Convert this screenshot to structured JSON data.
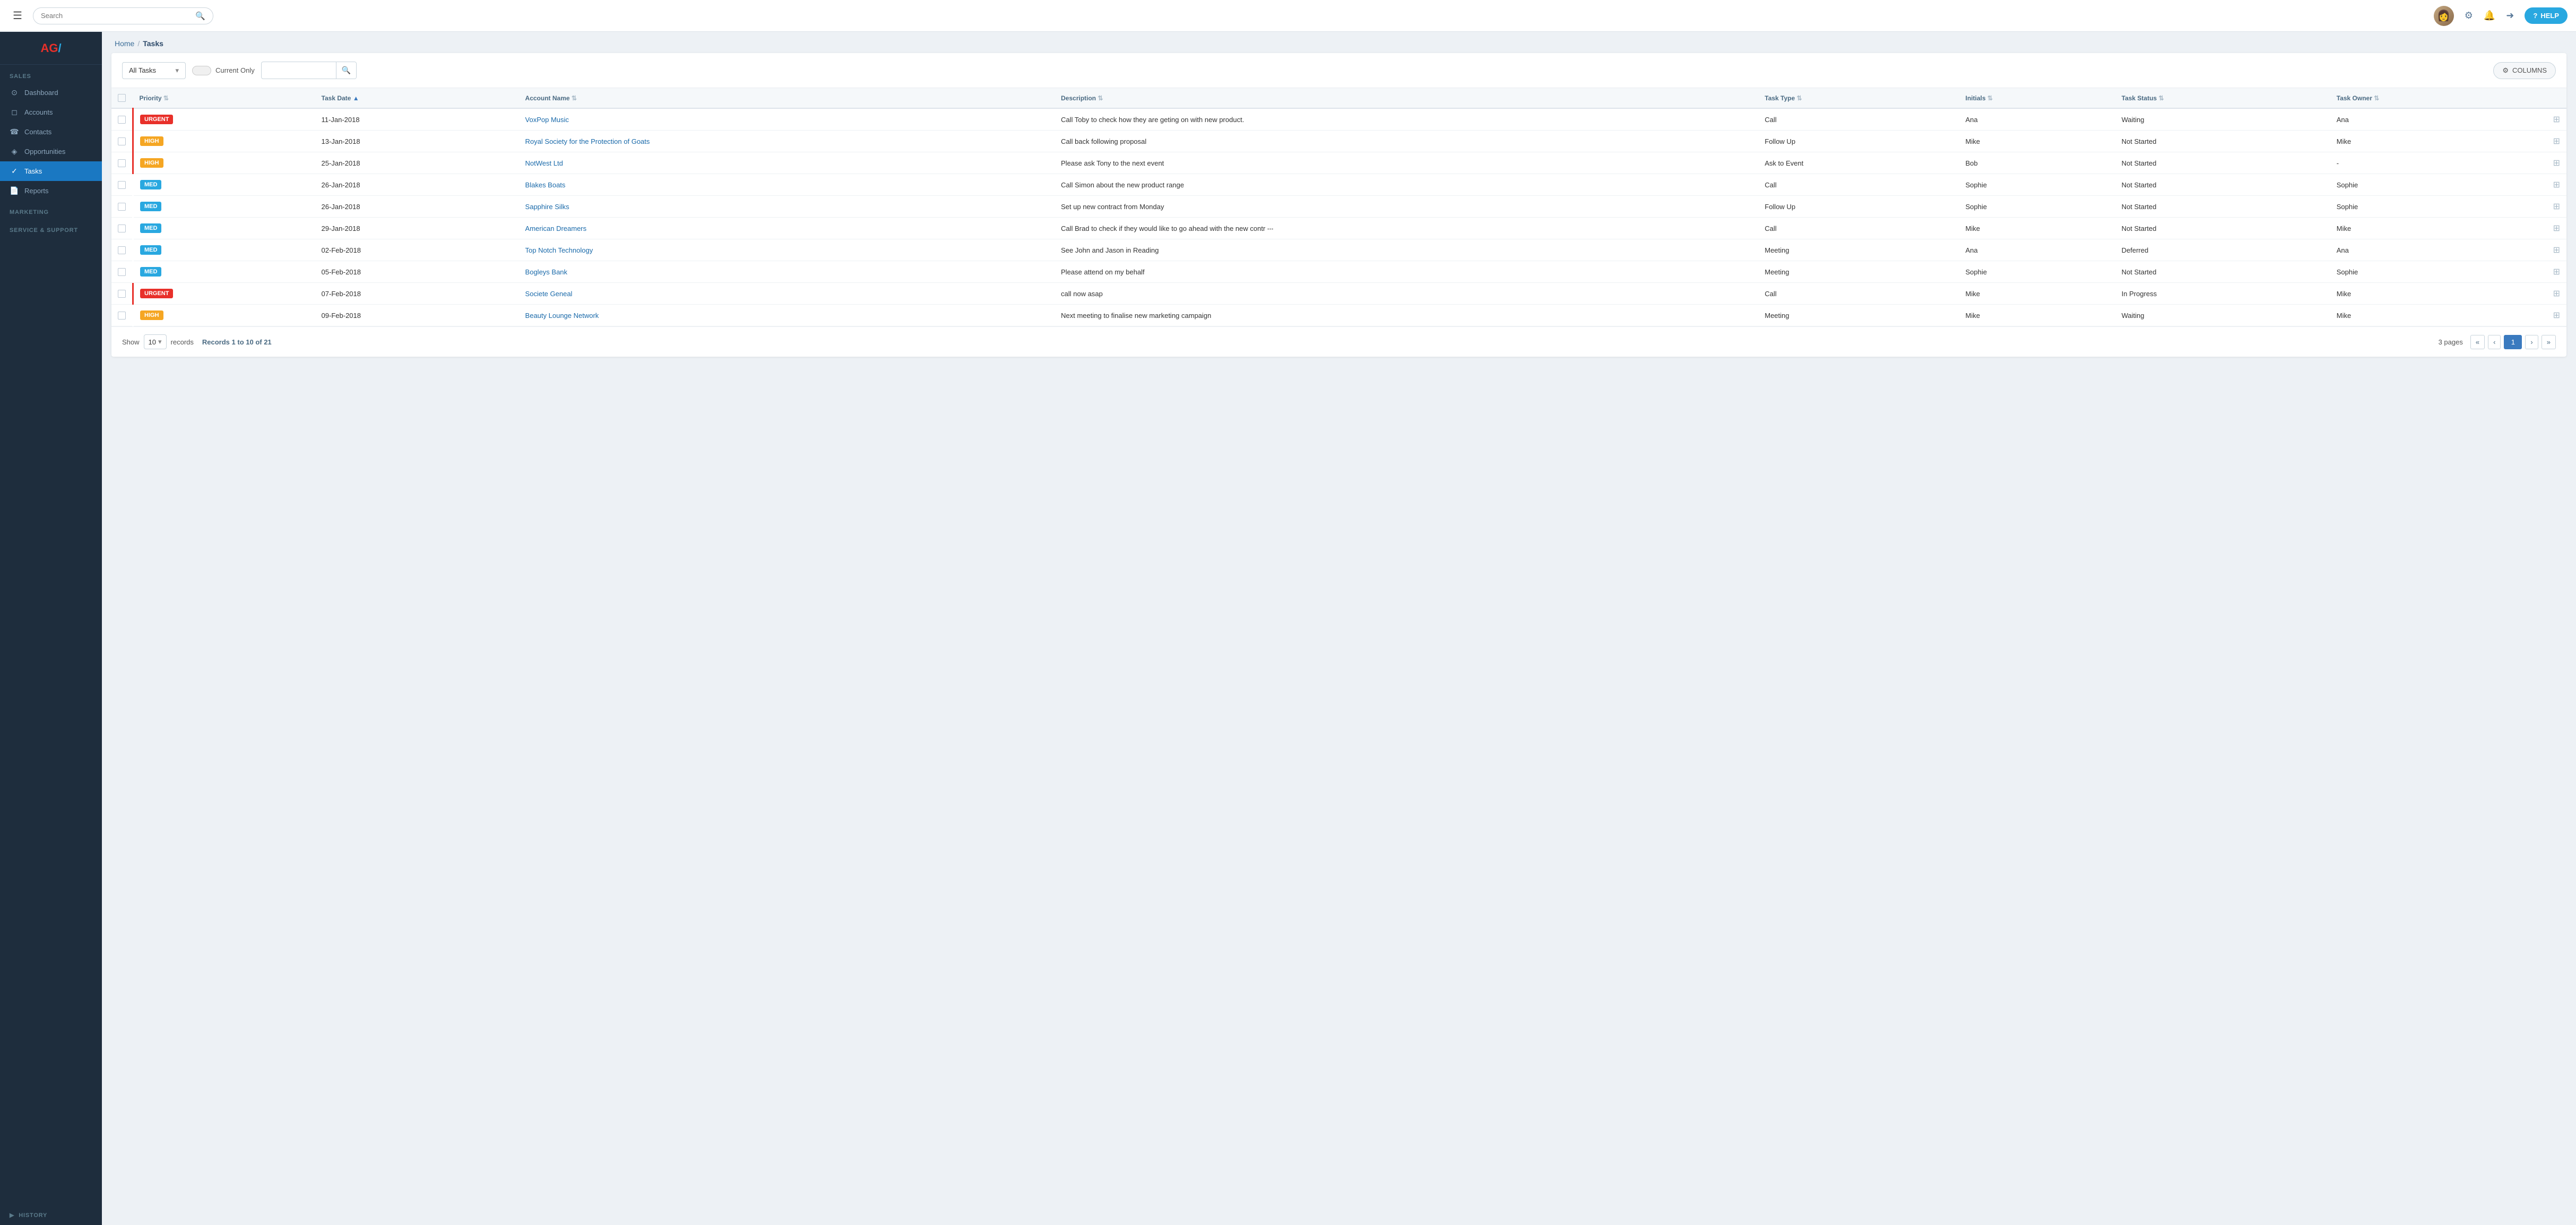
{
  "app": {
    "logo": "AG",
    "logo_line": "/"
  },
  "header": {
    "search_placeholder": "Search",
    "help_label": "HELP"
  },
  "sidebar": {
    "sections": [
      {
        "label": "SALES",
        "items": [
          {
            "id": "dashboard",
            "label": "Dashboard",
            "icon": "⊙",
            "active": false
          },
          {
            "id": "accounts",
            "label": "Accounts",
            "icon": "◻",
            "active": false
          },
          {
            "id": "contacts",
            "label": "Contacts",
            "icon": "☎",
            "active": false
          },
          {
            "id": "opportunities",
            "label": "Opportunities",
            "icon": "◈",
            "active": false
          },
          {
            "id": "tasks",
            "label": "Tasks",
            "icon": "✓",
            "active": true
          }
        ]
      },
      {
        "label": "MARKETING",
        "items": []
      },
      {
        "label": "SERVICE & SUPPORT",
        "items": []
      },
      {
        "label": "HISTORY",
        "items": [],
        "toggle": true
      }
    ]
  },
  "breadcrumb": {
    "home": "Home",
    "separator": "/",
    "current": "Tasks"
  },
  "toolbar": {
    "filter_label": "All Tasks",
    "current_only_label": "Current Only",
    "columns_label": "COLUMNS"
  },
  "table": {
    "columns": [
      {
        "id": "priority",
        "label": "Priority",
        "sortable": true,
        "sort": "none"
      },
      {
        "id": "task_date",
        "label": "Task Date",
        "sortable": true,
        "sort": "asc"
      },
      {
        "id": "account_name",
        "label": "Account Name",
        "sortable": true,
        "sort": "none"
      },
      {
        "id": "description",
        "label": "Description",
        "sortable": true,
        "sort": "none"
      },
      {
        "id": "task_type",
        "label": "Task Type",
        "sortable": true,
        "sort": "none"
      },
      {
        "id": "initials",
        "label": "Initials",
        "sortable": true,
        "sort": "none"
      },
      {
        "id": "task_status",
        "label": "Task Status",
        "sortable": true,
        "sort": "none"
      },
      {
        "id": "task_owner",
        "label": "Task Owner",
        "sortable": true,
        "sort": "none"
      }
    ],
    "rows": [
      {
        "priority": "Urgent",
        "priority_class": "urgent",
        "task_date": "11-Jan-2018",
        "account_name": "VoxPop Music",
        "description": "Call Toby to check how they are geting on with new product.",
        "task_type": "Call",
        "initials": "Ana",
        "task_status": "Waiting",
        "task_owner": "Ana",
        "red_bar": true,
        "truncated": false
      },
      {
        "priority": "High",
        "priority_class": "high",
        "task_date": "13-Jan-2018",
        "account_name": "Royal Society for the Protection of Goats",
        "description": "Call back following proposal",
        "task_type": "Follow Up",
        "initials": "Mike",
        "task_status": "Not Started",
        "task_owner": "Mike",
        "red_bar": true,
        "truncated": false
      },
      {
        "priority": "High",
        "priority_class": "high",
        "task_date": "25-Jan-2018",
        "account_name": "NotWest Ltd",
        "description": "Please ask Tony to the next event",
        "task_type": "Ask to Event",
        "initials": "Bob",
        "task_status": "Not Started",
        "task_owner": "-",
        "red_bar": true,
        "truncated": false
      },
      {
        "priority": "Med",
        "priority_class": "med",
        "task_date": "26-Jan-2018",
        "account_name": "Blakes Boats",
        "description": "Call Simon about the new product range",
        "task_type": "Call",
        "initials": "Sophie",
        "task_status": "Not Started",
        "task_owner": "Sophie",
        "red_bar": false,
        "truncated": false
      },
      {
        "priority": "Med",
        "priority_class": "med",
        "task_date": "26-Jan-2018",
        "account_name": "Sapphire Silks",
        "description": "Set up new contract from Monday",
        "task_type": "Follow Up",
        "initials": "Sophie",
        "task_status": "Not Started",
        "task_owner": "Sophie",
        "red_bar": false,
        "truncated": false
      },
      {
        "priority": "Med",
        "priority_class": "med",
        "task_date": "29-Jan-2018",
        "account_name": "American Dreamers",
        "description": "Call Brad to check if they would like to go ahead with the new contr",
        "task_type": "Call",
        "initials": "Mike",
        "task_status": "Not Started",
        "task_owner": "Mike",
        "red_bar": false,
        "truncated": true
      },
      {
        "priority": "Med",
        "priority_class": "med",
        "task_date": "02-Feb-2018",
        "account_name": "Top Notch Technology",
        "description": "See John and Jason in Reading",
        "task_type": "Meeting",
        "initials": "Ana",
        "task_status": "Deferred",
        "task_owner": "Ana",
        "red_bar": false,
        "truncated": false
      },
      {
        "priority": "Med",
        "priority_class": "med",
        "task_date": "05-Feb-2018",
        "account_name": "Bogleys Bank",
        "description": "Please attend on my behalf",
        "task_type": "Meeting",
        "initials": "Sophie",
        "task_status": "Not Started",
        "task_owner": "Sophie",
        "red_bar": false,
        "truncated": false
      },
      {
        "priority": "Urgent",
        "priority_class": "urgent",
        "task_date": "07-Feb-2018",
        "account_name": "Societe Geneal",
        "description": "call now asap",
        "task_type": "Call",
        "initials": "Mike",
        "task_status": "In Progress",
        "task_owner": "Mike",
        "red_bar": true,
        "truncated": false
      },
      {
        "priority": "High",
        "priority_class": "high",
        "task_date": "09-Feb-2018",
        "account_name": "Beauty Lounge Network",
        "description": "Next meeting to finalise new marketing campaign",
        "task_type": "Meeting",
        "initials": "Mike",
        "task_status": "Waiting",
        "task_owner": "Mike",
        "red_bar": false,
        "truncated": false
      }
    ]
  },
  "pagination": {
    "show_label": "Show",
    "per_page": "10",
    "records_label": "records",
    "records_info": "Records 1 to 10 of 21",
    "pages_label": "3 pages",
    "current_page": "1",
    "btn_first": "«",
    "btn_prev": "‹",
    "btn_next": "›",
    "btn_last": "»"
  }
}
